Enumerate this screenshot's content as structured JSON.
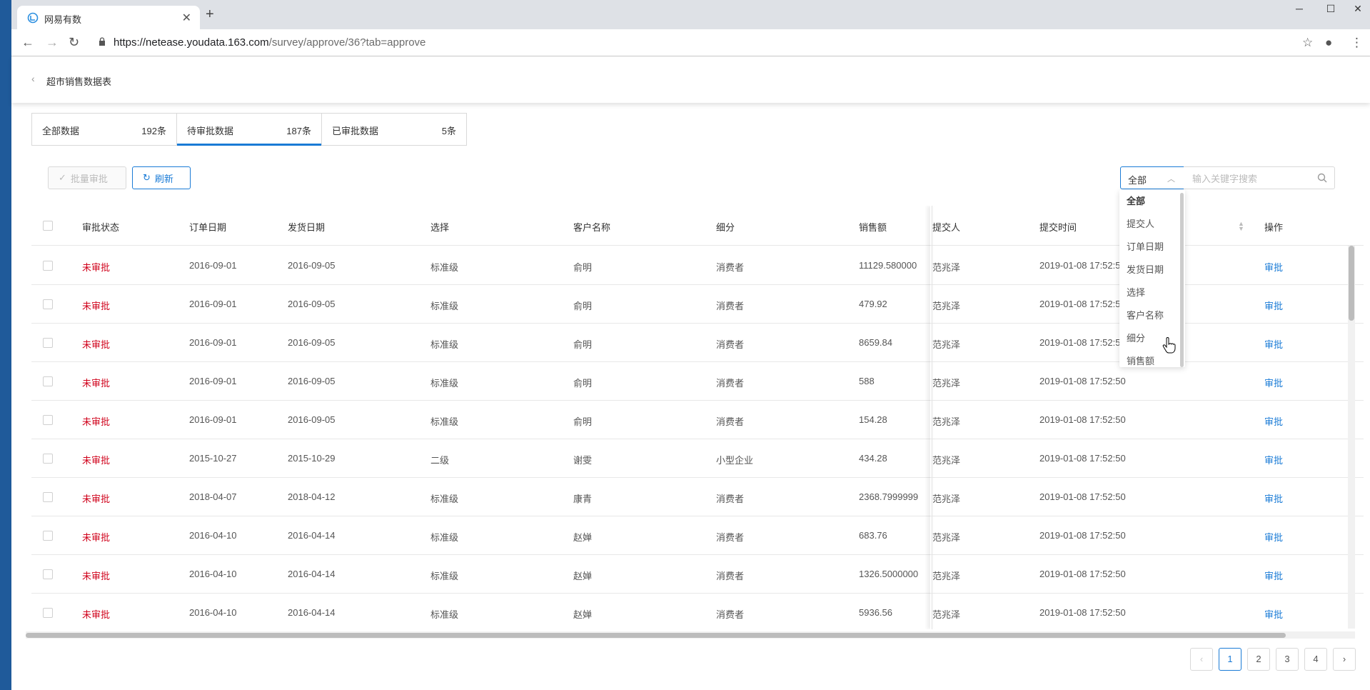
{
  "browser": {
    "tab_title": "网易有数",
    "url_host": "https://netease.youdata.163.com",
    "url_path": "/survey/approve/36?tab=approve"
  },
  "header": {
    "breadcrumb": "超市销售数据表"
  },
  "tabs": [
    {
      "label": "全部数据",
      "count": "192条"
    },
    {
      "label": "待审批数据",
      "count": "187条"
    },
    {
      "label": "已审批数据",
      "count": "5条"
    }
  ],
  "toolbar": {
    "batch_label": "批量审批",
    "refresh_label": "刷新",
    "filter_value": "全部",
    "search_placeholder": "输入关键字搜索"
  },
  "dropdown": {
    "options": [
      "全部",
      "提交人",
      "订单日期",
      "发货日期",
      "选择",
      "客户名称",
      "细分",
      "销售额"
    ]
  },
  "table": {
    "headers": [
      "审批状态",
      "订单日期",
      "发货日期",
      "选择",
      "客户名称",
      "细分",
      "销售额",
      "提交人",
      "提交时间",
      "操作"
    ],
    "rows": [
      {
        "status": "未审批",
        "order_date": "2016-09-01",
        "ship_date": "2016-09-05",
        "choice": "标准级",
        "customer": "俞明",
        "segment": "消费者",
        "sales": "11129.580000",
        "submitter": "范兆泽",
        "submit_time": "2019-01-08 17:52:50",
        "action": "审批"
      },
      {
        "status": "未审批",
        "order_date": "2016-09-01",
        "ship_date": "2016-09-05",
        "choice": "标准级",
        "customer": "俞明",
        "segment": "消费者",
        "sales": "479.92",
        "submitter": "范兆泽",
        "submit_time": "2019-01-08 17:52:50",
        "action": "审批"
      },
      {
        "status": "未审批",
        "order_date": "2016-09-01",
        "ship_date": "2016-09-05",
        "choice": "标准级",
        "customer": "俞明",
        "segment": "消费者",
        "sales": "8659.84",
        "submitter": "范兆泽",
        "submit_time": "2019-01-08 17:52:50",
        "action": "审批"
      },
      {
        "status": "未审批",
        "order_date": "2016-09-01",
        "ship_date": "2016-09-05",
        "choice": "标准级",
        "customer": "俞明",
        "segment": "消费者",
        "sales": "588",
        "submitter": "范兆泽",
        "submit_time": "2019-01-08 17:52:50",
        "action": "审批"
      },
      {
        "status": "未审批",
        "order_date": "2016-09-01",
        "ship_date": "2016-09-05",
        "choice": "标准级",
        "customer": "俞明",
        "segment": "消费者",
        "sales": "154.28",
        "submitter": "范兆泽",
        "submit_time": "2019-01-08 17:52:50",
        "action": "审批"
      },
      {
        "status": "未审批",
        "order_date": "2015-10-27",
        "ship_date": "2015-10-29",
        "choice": "二级",
        "customer": "谢雯",
        "segment": "小型企业",
        "sales": "434.28",
        "submitter": "范兆泽",
        "submit_time": "2019-01-08 17:52:50",
        "action": "审批"
      },
      {
        "status": "未审批",
        "order_date": "2018-04-07",
        "ship_date": "2018-04-12",
        "choice": "标准级",
        "customer": "康青",
        "segment": "消费者",
        "sales": "2368.7999999",
        "submitter": "范兆泽",
        "submit_time": "2019-01-08 17:52:50",
        "action": "审批"
      },
      {
        "status": "未审批",
        "order_date": "2016-04-10",
        "ship_date": "2016-04-14",
        "choice": "标准级",
        "customer": "赵婵",
        "segment": "消费者",
        "sales": "683.76",
        "submitter": "范兆泽",
        "submit_time": "2019-01-08 17:52:50",
        "action": "审批"
      },
      {
        "status": "未审批",
        "order_date": "2016-04-10",
        "ship_date": "2016-04-14",
        "choice": "标准级",
        "customer": "赵婵",
        "segment": "消费者",
        "sales": "1326.5000000",
        "submitter": "范兆泽",
        "submit_time": "2019-01-08 17:52:50",
        "action": "审批"
      },
      {
        "status": "未审批",
        "order_date": "2016-04-10",
        "ship_date": "2016-04-14",
        "choice": "标准级",
        "customer": "赵婵",
        "segment": "消费者",
        "sales": "5936.56",
        "submitter": "范兆泽",
        "submit_time": "2019-01-08 17:52:50",
        "action": "审批"
      }
    ]
  },
  "pagination": {
    "pages": [
      "1",
      "2",
      "3",
      "4"
    ],
    "current": "1"
  },
  "colors": {
    "accent": "#1a7bd6",
    "status_pending": "#d0021b"
  }
}
